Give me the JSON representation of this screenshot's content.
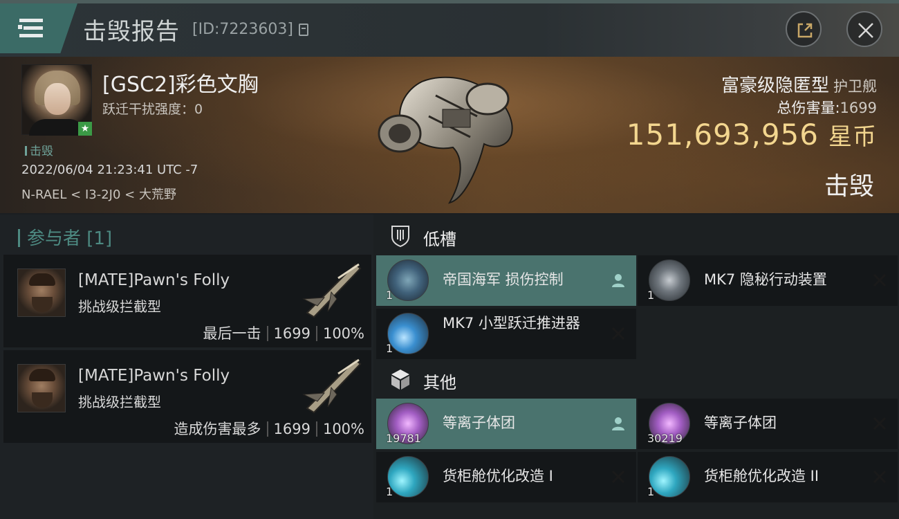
{
  "header": {
    "title": "击毁报告",
    "report_id": "[ID:7223603]"
  },
  "victim": {
    "name": "[GSC2]彩色文胸",
    "warp_label": "跃迁干扰强度：0",
    "status": "击毁",
    "timestamp": "2022/06/04 21:23:41 UTC -7",
    "location": "N-RAEL < I3-2J0 < 大荒野",
    "ship_type": "富豪级隐匿型",
    "ship_class": "护卫舰",
    "damage_label": "总伤害量:",
    "damage_value": "1699",
    "isk_value": "151,693,956",
    "isk_unit": "星币",
    "outcome": "击毁"
  },
  "participants": {
    "title": "参与者 [1]",
    "cards": [
      {
        "name": "[MATE]Pawn's Folly",
        "ship": "挑战级拦截型",
        "role": "最后一击",
        "damage": "1699",
        "percent": "100%"
      },
      {
        "name": "[MATE]Pawn's Folly",
        "ship": "挑战级拦截型",
        "role": "造成伤害最多",
        "damage": "1699",
        "percent": "100%"
      }
    ]
  },
  "fitting": {
    "low_slot_title": "低槽",
    "other_title": "其他",
    "low_slots": [
      {
        "name": "帝国海军 损伤控制",
        "qty": "1",
        "state": "dropped",
        "action_icon": "person-icon"
      },
      {
        "name": "MK7 隐秘行动装置",
        "qty": "1",
        "state": "destroyed",
        "action_icon": "x-icon"
      },
      {
        "name": "MK7 小型跃迁推进器",
        "qty": "1",
        "state": "destroyed",
        "action_icon": "x-icon"
      }
    ],
    "other": [
      {
        "name": "等离子体团",
        "qty": "19781",
        "state": "dropped",
        "action_icon": "person-icon"
      },
      {
        "name": "等离子体团",
        "qty": "30219",
        "state": "destroyed",
        "action_icon": "x-icon"
      },
      {
        "name": "货柜舱优化改造 I",
        "qty": "1",
        "state": "destroyed",
        "action_icon": "x-icon"
      },
      {
        "name": "货柜舱优化改造 II",
        "qty": "1",
        "state": "destroyed",
        "action_icon": "x-icon"
      }
    ]
  },
  "colors": {
    "accent": "#4a736e",
    "isk": "#f3d68f",
    "teal_text": "#4d8a82"
  }
}
